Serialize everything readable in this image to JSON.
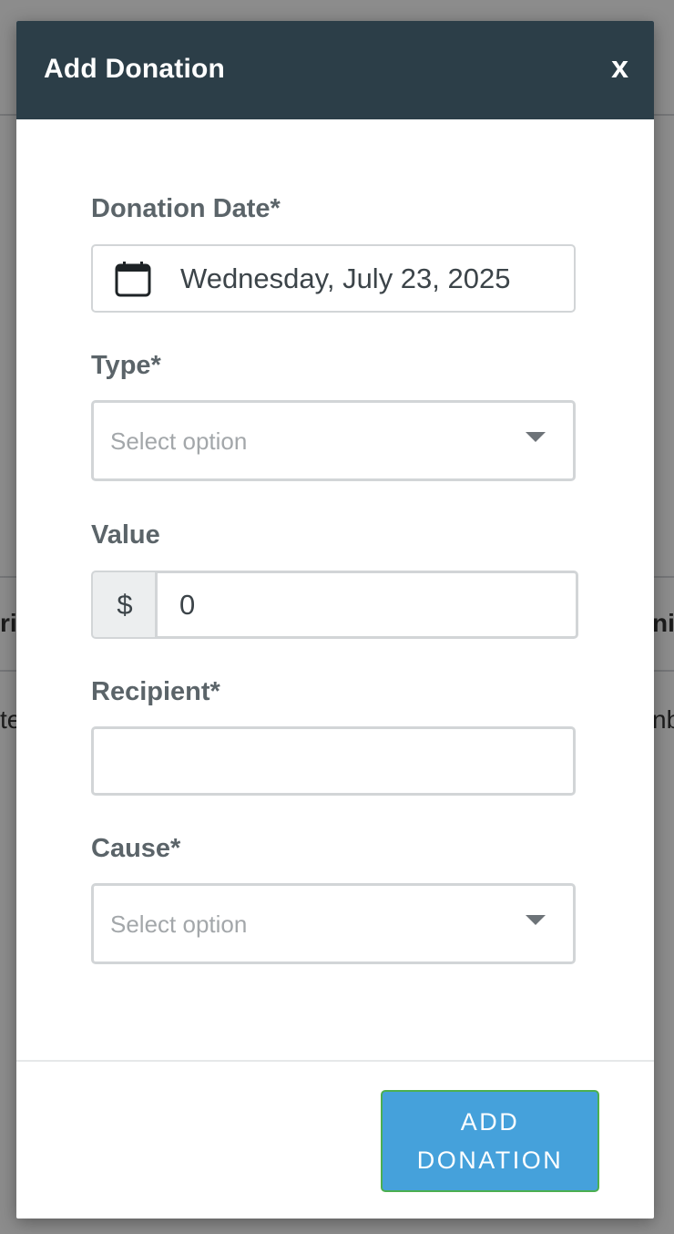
{
  "background": {
    "left_fragments": [
      "ri",
      "te"
    ],
    "right_fragments": [
      "ni",
      "nb"
    ]
  },
  "modal": {
    "title": "Add Donation",
    "close_label": "x",
    "fields": {
      "date": {
        "label": "Donation Date*",
        "value": "Wednesday, July 23, 2025",
        "icon": "calendar-icon"
      },
      "type": {
        "label": "Type*",
        "placeholder": "Select option",
        "icon": "caret-down-icon"
      },
      "value": {
        "label": "Value",
        "currency_symbol": "$",
        "value": "0"
      },
      "recipient": {
        "label": "Recipient*",
        "value": ""
      },
      "cause": {
        "label": "Cause*",
        "placeholder": "Select option",
        "icon": "caret-down-icon"
      }
    },
    "submit_label": "ADD DONATION"
  },
  "colors": {
    "header_bg": "#2c3e48",
    "button_bg": "#45a1db",
    "button_border": "#4caf50"
  }
}
